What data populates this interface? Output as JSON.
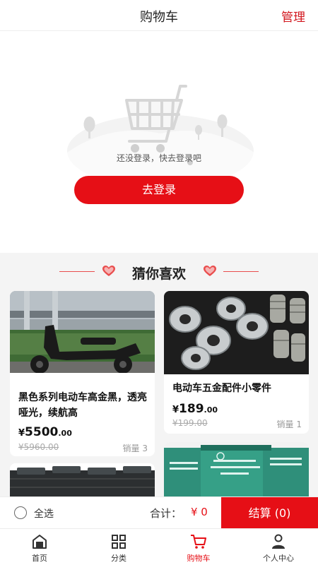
{
  "header": {
    "title": "购物车",
    "manage_label": "管理"
  },
  "empty": {
    "message": "还没登录，快去登录吧",
    "login_button": "去登录"
  },
  "recommend": {
    "title": "猜你喜欢",
    "products": [
      {
        "name": "黑色系列电动车高金黑，透亮哑光，续航高",
        "price_int": "5500",
        "price_dec": ".00",
        "original_price": "¥5960.00",
        "sales": "销量 3"
      },
      {
        "name": "电动车五金配件小零件",
        "price_int": "189",
        "price_dec": ".00",
        "original_price": "¥199.00",
        "sales": "销量 1"
      }
    ]
  },
  "checkout": {
    "select_all": "全选",
    "total_label": "合计：",
    "total_value": "¥ 0",
    "button": "结算 (0)"
  },
  "tabbar": {
    "items": [
      {
        "label": "首页",
        "icon": "home-icon"
      },
      {
        "label": "分类",
        "icon": "grid-icon"
      },
      {
        "label": "购物车",
        "icon": "cart-icon"
      },
      {
        "label": "个人中心",
        "icon": "user-icon"
      }
    ]
  },
  "currency_symbol": "¥",
  "colors": {
    "accent": "#e60f16",
    "background": "#f4f4f4"
  }
}
